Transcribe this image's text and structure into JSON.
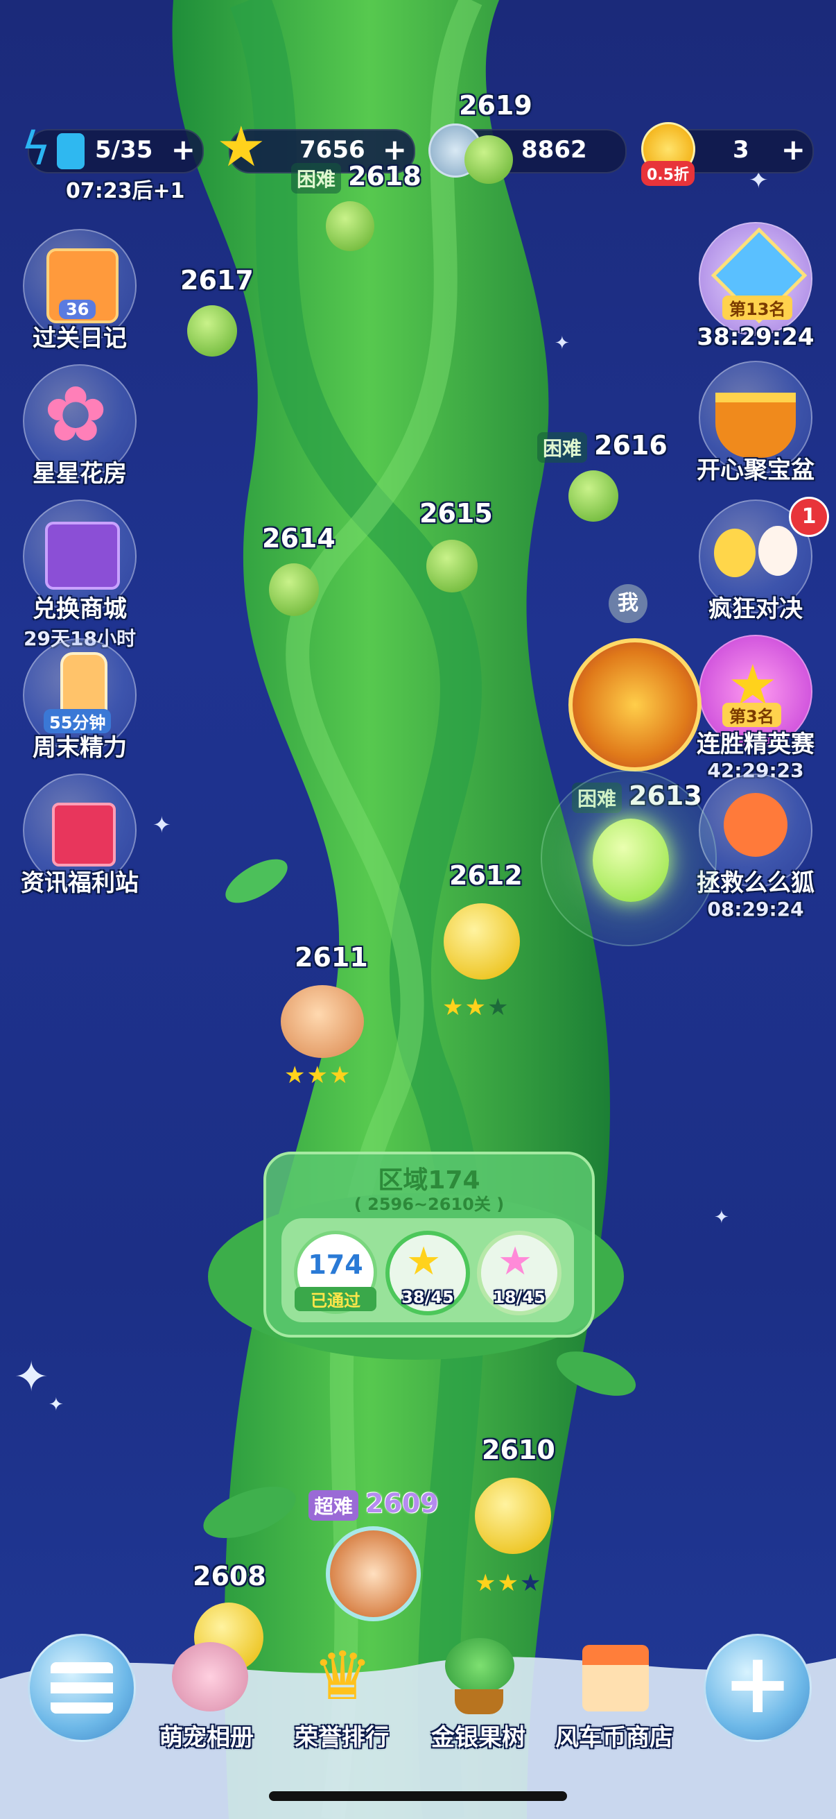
{
  "resources": {
    "energy": {
      "value": "5/35",
      "timer": "07:23后+1",
      "fill": 0.14
    },
    "stars": {
      "value": "7656"
    },
    "coins": {
      "value": "8862"
    },
    "tickets": {
      "value": "3",
      "discount": "0.5折"
    }
  },
  "left_buttons": [
    {
      "label": "过关日记",
      "badge": "36"
    },
    {
      "label": "星星花房"
    },
    {
      "label": "兑换商城",
      "sub": "29天18小时"
    },
    {
      "label": "周末精力",
      "badge": "55分钟"
    },
    {
      "label": "资讯福利站"
    }
  ],
  "right_buttons": [
    {
      "label": "38:29:24",
      "badge": "第13名"
    },
    {
      "label": "开心聚宝盆"
    },
    {
      "label": "疯狂对决",
      "notify": "1"
    },
    {
      "label": "连胜精英赛",
      "badge": "第3名",
      "sub": "42:29:23"
    },
    {
      "label": "拯救么么狐",
      "sub": "08:29:24"
    }
  ],
  "levels": {
    "l2619": "2619",
    "l2618": "2618",
    "l2618_tag": "困难",
    "l2617": "2617",
    "l2616": "2616",
    "l2616_tag": "困难",
    "l2615": "2615",
    "l2614": "2614",
    "l2613": "2613",
    "l2613_tag": "困难",
    "l2612": "2612",
    "l2612_stars": 2,
    "l2611": "2611",
    "l2611_stars": 3,
    "l2610": "2610",
    "l2610_stars": 2,
    "l2609": "2609",
    "l2609_tag": "超难",
    "l2608": "2608"
  },
  "me_label": "我",
  "zone": {
    "title": "区域174",
    "range": "( 2596~2610关 )",
    "number": "174",
    "passed": "已通过",
    "stars": "38/45",
    "rainbow": "18/45"
  },
  "nav": [
    "萌宠相册",
    "荣誉排行",
    "金银果树",
    "风车币商店"
  ],
  "colors": {
    "accent_green": "#3fbf4a",
    "star_gold": "#ffd21c",
    "bg": "#1f3390"
  }
}
